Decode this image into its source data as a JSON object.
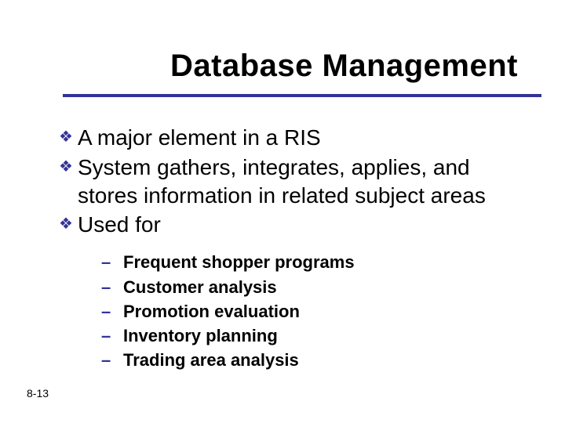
{
  "slide": {
    "title": "Database Management",
    "bullets": [
      {
        "text": "A major element in a RIS"
      },
      {
        "text": "System gathers, integrates, applies, and stores information in related subject areas"
      },
      {
        "text": "Used for"
      }
    ],
    "subitems": [
      {
        "text": "Frequent shopper programs"
      },
      {
        "text": "Customer analysis"
      },
      {
        "text": "Promotion evaluation"
      },
      {
        "text": "Inventory planning"
      },
      {
        "text": "Trading area analysis"
      }
    ],
    "page_number": "8-13"
  }
}
